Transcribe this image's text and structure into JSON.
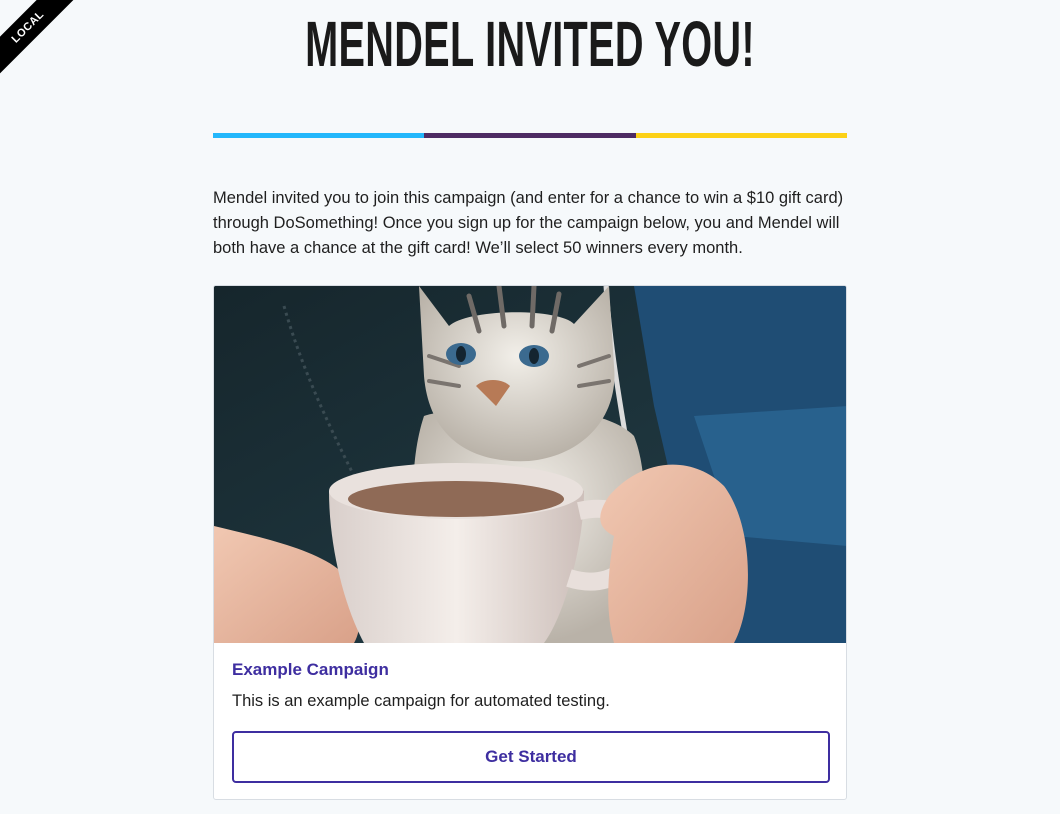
{
  "environment": {
    "label": "LOCAL"
  },
  "header": {
    "title": "MENDEL INVITED YOU!"
  },
  "divider": {
    "colors": [
      "#23b7fb",
      "#4e2b63",
      "#fcd116"
    ]
  },
  "intro": {
    "text": "Mendel invited you to join this campaign (and enter for a chance to win a $10 gift card) through DoSomething! Once you sign up for the campaign below, you and Mendel will both have a chance at the gift card! We’ll select 50 winners every month."
  },
  "campaign": {
    "title": "Example Campaign",
    "description": "This is an example campaign for automated testing.",
    "cta_label": "Get Started",
    "accent_color": "#3e2ea0"
  }
}
